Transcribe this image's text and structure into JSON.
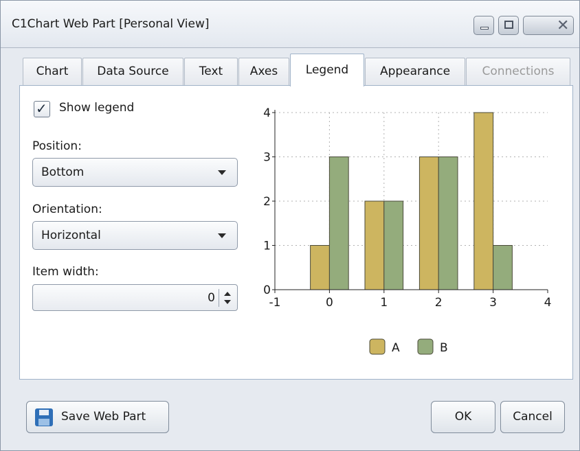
{
  "window": {
    "title": "C1Chart Web Part [Personal View]"
  },
  "tabs": [
    {
      "label": "Chart",
      "state": "normal"
    },
    {
      "label": "Data Source",
      "state": "normal"
    },
    {
      "label": "Text",
      "state": "normal"
    },
    {
      "label": "Axes",
      "state": "normal"
    },
    {
      "label": "Legend",
      "state": "active"
    },
    {
      "label": "Appearance",
      "state": "normal"
    },
    {
      "label": "Connections",
      "state": "disabled"
    }
  ],
  "legend_settings": {
    "show_legend_label": "Show legend",
    "show_legend_checked": true,
    "position_label": "Position:",
    "position_value": "Bottom",
    "orientation_label": "Orientation:",
    "orientation_value": "Horizontal",
    "item_width_label": "Item width:",
    "item_width_value": "0"
  },
  "chart_data": {
    "type": "bar",
    "x_ticks": [
      "-1",
      "0",
      "1",
      "2",
      "3",
      "4"
    ],
    "y_ticks": [
      "0",
      "1",
      "2",
      "3",
      "4"
    ],
    "xlim": [
      -1,
      4
    ],
    "ylim": [
      0,
      4
    ],
    "grid": true,
    "legend_position": "bottom",
    "categories": [
      0,
      1,
      2,
      3
    ],
    "series": [
      {
        "name": "A",
        "values": [
          1,
          2,
          3,
          4
        ],
        "color": "#cdb560"
      },
      {
        "name": "B",
        "values": [
          3,
          2,
          3,
          1
        ],
        "color": "#94ac7c"
      }
    ]
  },
  "footer": {
    "save_label": "Save Web Part",
    "ok_label": "OK",
    "cancel_label": "Cancel"
  },
  "icons": {
    "save": "floppy-disk-icon",
    "minimize": "minimize-icon",
    "maximize": "maximize-icon",
    "close": "close-icon",
    "check": "checkmark-icon",
    "dropdown": "chevron-down-icon",
    "spinner": "spinner-arrows-icon"
  }
}
